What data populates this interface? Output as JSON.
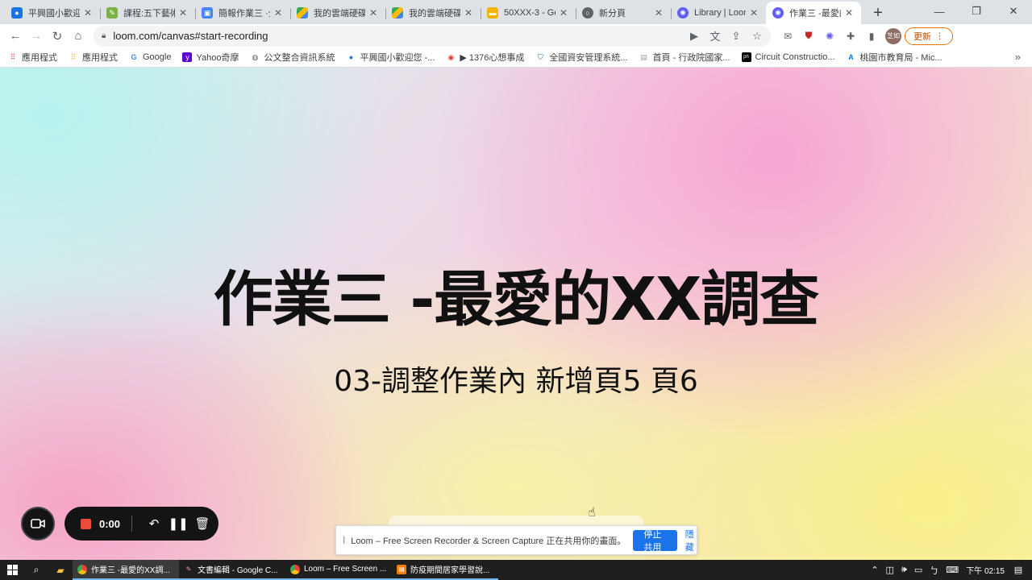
{
  "browser": {
    "tabs": [
      {
        "title": "平興國小歡迎您",
        "color": "#1a73e8"
      },
      {
        "title": "課程:五下藝術",
        "color": "#7cb342"
      },
      {
        "title": "簡報作業三 ·全",
        "color": "#4285f4"
      },
      {
        "title": "我的雲端硬碟",
        "color": "#fbbc04"
      },
      {
        "title": "我的雲端硬碟",
        "color": "#34a853"
      },
      {
        "title": "50XXX-3 - Go",
        "color": "#f4b400"
      },
      {
        "title": "新分頁",
        "color": "#5f6368"
      },
      {
        "title": "Library | Loom",
        "color": "#625df5"
      },
      {
        "title": "作業三 -最愛的",
        "color": "#625df5"
      }
    ],
    "url": "loom.com/canvas#start-recording",
    "update_label": "更新",
    "avatar_text": "芝如",
    "bookmarks": [
      {
        "label": "應用程式",
        "icon": "apps-grid-icon",
        "color": "#ea4335"
      },
      {
        "label": "應用程式",
        "icon": "apps-grid-icon",
        "color": "#fbbc04"
      },
      {
        "label": "Google",
        "icon": "google-icon",
        "color": "#4285f4"
      },
      {
        "label": "Yahoo奇摩",
        "icon": "yahoo-icon",
        "color": "#6001d2"
      },
      {
        "label": "公文整合資訊系統",
        "icon": "globe-icon",
        "color": "#5f6368"
      },
      {
        "label": "平興國小歡迎您 -...",
        "icon": "school-icon",
        "color": "#1a73e8"
      },
      {
        "label": "▶ 1376心想事成",
        "icon": "target-icon",
        "color": "#e53935"
      },
      {
        "label": "全國資安管理系統...",
        "icon": "shield-icon",
        "color": "#1565c0"
      },
      {
        "label": "首頁 - 行政院國家...",
        "icon": "doc-icon",
        "color": "#90a4ae"
      },
      {
        "label": "Circuit Constructio...",
        "icon": "phet-icon",
        "color": "#000000"
      },
      {
        "label": "桃園市教育局 - Mic...",
        "icon": "azure-icon",
        "color": "#0078d4"
      }
    ]
  },
  "slide": {
    "title": "作業三 -最愛的XX調查",
    "subtitle": "03-調整作業內 新增頁5 頁6"
  },
  "loom": {
    "timer": "0:00"
  },
  "share_notice": {
    "text": "Loom – Free Screen Recorder & Screen Capture 正在共用你的畫面。",
    "stop_label": "停止共用",
    "hide_label": "隱藏"
  },
  "taskbar": {
    "tasks": [
      {
        "title": "作業三 -最愛的XX調...",
        "color": "#ea4335"
      },
      {
        "title": "文書編輯 - Google C...",
        "color": "#c2185b"
      },
      {
        "title": "Loom – Free Screen ...",
        "color": "#4285f4"
      },
      {
        "title": "防疫期間居家學習說...",
        "color": "#f57c00"
      }
    ],
    "clock": "下午 02:15"
  }
}
